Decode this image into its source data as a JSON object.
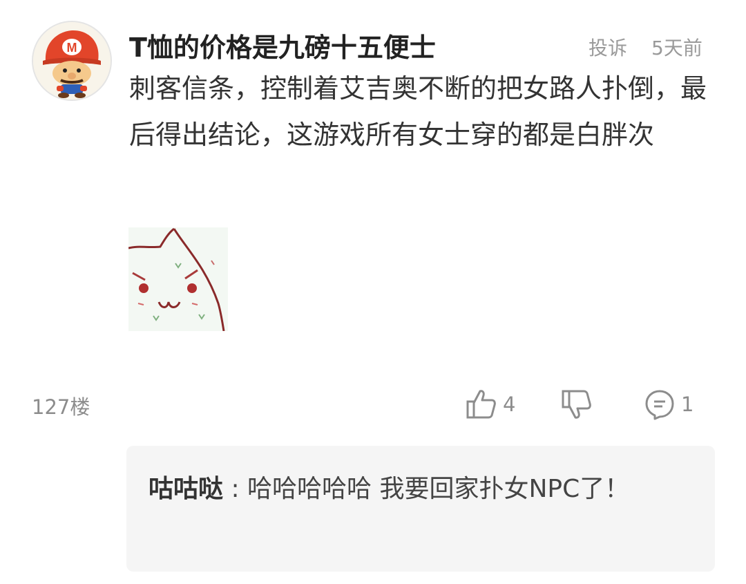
{
  "comment": {
    "username": "T恤的价格是九磅十五便士",
    "report_label": "投诉",
    "time": "5天前",
    "text": "刺客信条，控制着艾吉奥不断的把女路人扑倒，最后得出结论，这游戏所有女士穿的都是白胖次",
    "avatar_icon": "mario-avatar-icon",
    "sticker_icon": "cat-emoji-sticker-icon",
    "floor": "127楼",
    "like_count": "4",
    "reply_count": "1"
  },
  "reply": {
    "author": "咕咕哒",
    "separator": " : ",
    "text": "哈哈哈哈哈 我要回家扑女NPC了！"
  },
  "colors": {
    "text_primary": "#333333",
    "text_secondary": "#8c8c8c",
    "reply_background": "#f5f5f5"
  }
}
